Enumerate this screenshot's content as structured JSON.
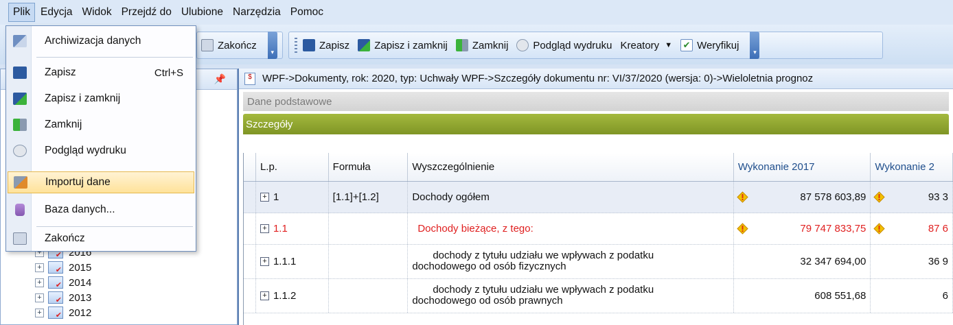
{
  "menubar": {
    "items": [
      "Plik",
      "Edycja",
      "Widok",
      "Przejdź do",
      "Ulubione",
      "Narzędzia",
      "Pomoc"
    ]
  },
  "toolbar": {
    "zakoncz": "Zakończ",
    "zapisz": "Zapisz",
    "zapisz_zamknij": "Zapisz i zamknij",
    "zamknij": "Zamknij",
    "podglad": "Podgląd wydruku",
    "kreatory": "Kreatory",
    "weryfikuj": "Weryfikuj"
  },
  "file_menu": {
    "items": [
      {
        "label": "Archiwizacja danych",
        "shortcut": "",
        "icon": "archive-icon"
      },
      {
        "label": "Zapisz",
        "shortcut": "Ctrl+S",
        "icon": "save-icon"
      },
      {
        "label": "Zapisz i zamknij",
        "shortcut": "",
        "icon": "save-close-icon"
      },
      {
        "label": "Zamknij",
        "shortcut": "",
        "icon": "close-icon"
      },
      {
        "label": "Podgląd wydruku",
        "shortcut": "",
        "icon": "print-preview-icon"
      },
      {
        "label": "Importuj dane",
        "shortcut": "",
        "icon": "import-icon"
      },
      {
        "label": "Baza danych...",
        "shortcut": "",
        "icon": "database-icon"
      },
      {
        "label": "Zakończ",
        "shortcut": "",
        "icon": "exit-icon"
      }
    ]
  },
  "tree": {
    "items": [
      "2016",
      "2015",
      "2014",
      "2013",
      "2012"
    ]
  },
  "document": {
    "path": "WPF->Dokumenty, rok: 2020, typ: Uchwały WPF->Szczegóły dokumentu nr: VI/37/2020 (wersja: 0)->Wieloletnia prognoz",
    "basic_label": "Dane podstawowe",
    "details_label": "Szczegóły"
  },
  "table": {
    "headers": {
      "lp": "L.p.",
      "formula": "Formuła",
      "desc": "Wyszczególnienie",
      "w2017": "Wykonanie 2017",
      "w2018": "Wykonanie 2"
    },
    "rows": [
      {
        "lp": "1",
        "formula": "[1.1]+[1.2]",
        "desc": "Dochody ogółem",
        "w2017": "87 578 603,89",
        "w2018": "93 3"
      },
      {
        "lp": "1.1",
        "formula": "",
        "desc": "Dochody bieżące, z tego:",
        "w2017": "79 747 833,75",
        "w2018": "87 6"
      },
      {
        "lp": "1.1.1",
        "formula": "",
        "desc_line1": "dochody z tytułu udziału we wpływach z podatku",
        "desc_line2": "dochodowego od osób fizycznych",
        "w2017": "32 347 694,00",
        "w2018": "36 9"
      },
      {
        "lp": "1.1.2",
        "formula": "",
        "desc_line1": "dochody z tytułu udziału we wpływach z podatku",
        "desc_line2": "dochodowego od osób prawnych",
        "w2017": "608 551,68",
        "w2018": "6"
      }
    ]
  },
  "colors": {
    "accent": "#8da42e",
    "red_text": "#e02020",
    "highlight": "#ffe29a"
  }
}
